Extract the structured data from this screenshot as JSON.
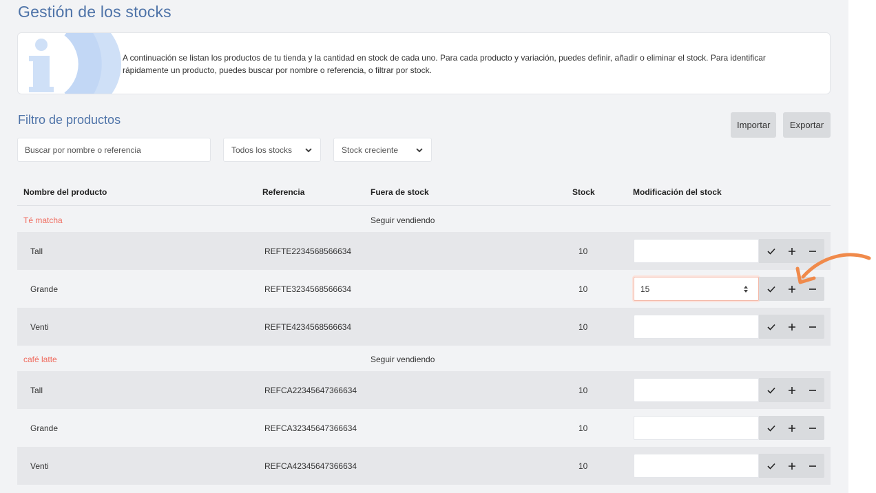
{
  "page": {
    "title": "Gestión de los stocks"
  },
  "info": {
    "text": "A continuación se listan los productos de tu tienda y la cantidad en stock de cada uno. Para cada producto y variación, puedes definir, añadir o eliminar el stock. Para identificar rápidamente un producto, puedes buscar por nombre o referencia, o filtrar por stock.",
    "icon": "info-icon"
  },
  "filter": {
    "title": "Filtro de productos",
    "import_label": "Importar",
    "export_label": "Exportar",
    "search_placeholder": "Buscar por nombre o referencia",
    "stock_filter_value": "Todos los stocks",
    "sort_value": "Stock creciente"
  },
  "table": {
    "headers": {
      "name": "Nombre del producto",
      "reference": "Referencia",
      "out_of_stock": "Fuera de stock",
      "stock": "Stock",
      "modification": "Modificación del stock"
    },
    "products": [
      {
        "name": "Té matcha",
        "out_of_stock": "Seguir vendiendo",
        "variants": [
          {
            "name": "Tall",
            "reference": "REFTE2234568566634",
            "stock": "10",
            "modification": ""
          },
          {
            "name": "Grande",
            "reference": "REFTE3234568566634",
            "stock": "10",
            "modification": "15"
          },
          {
            "name": "Venti",
            "reference": "REFTE4234568566634",
            "stock": "10",
            "modification": ""
          }
        ]
      },
      {
        "name": "café latte",
        "out_of_stock": "Seguir vendiendo",
        "variants": [
          {
            "name": "Tall",
            "reference": "REFCA22345647366634",
            "stock": "10",
            "modification": ""
          },
          {
            "name": "Grande",
            "reference": "REFCA32345647366634",
            "stock": "10",
            "modification": ""
          },
          {
            "name": "Venti",
            "reference": "REFCA42345647366634",
            "stock": "10",
            "modification": ""
          }
        ]
      }
    ]
  },
  "colors": {
    "title": "#4e73a8",
    "product_name": "#f06b5e",
    "accent_arrow": "#f08a4b",
    "row_shade": "#e6e7ea",
    "button_gray": "#d9dbde"
  }
}
